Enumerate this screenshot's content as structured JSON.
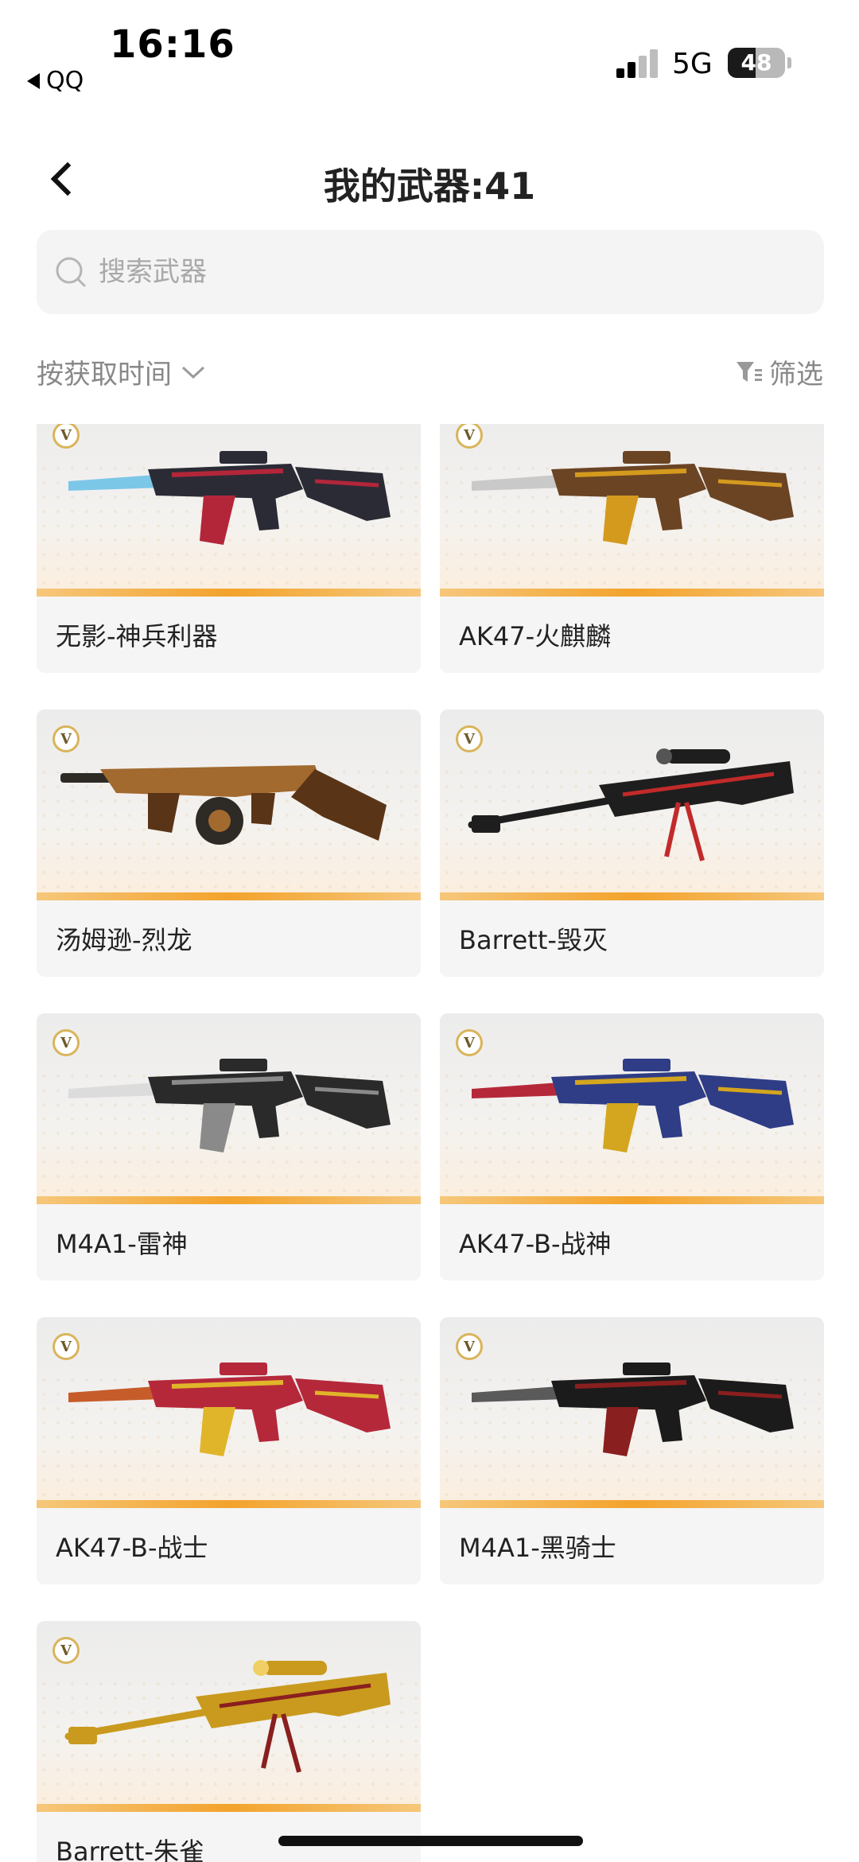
{
  "status_bar": {
    "time": "16:16",
    "back_app": "QQ",
    "network": "5G",
    "battery": "48",
    "battery_level": 0.48
  },
  "header": {
    "back_icon": "chevron-left-icon",
    "title": "我的武器:41"
  },
  "search": {
    "placeholder": "搜索武器",
    "icon": "search-icon"
  },
  "toolbar": {
    "sort_label": "按获取时间",
    "sort_icon": "chevron-down-icon",
    "filter_label": "筛选",
    "filter_icon": "funnel-icon"
  },
  "weapons": [
    {
      "name": "无影-神兵利器",
      "badge": "V",
      "icon": "rifle-image",
      "palette": [
        "#2b2b35",
        "#b3263a",
        "#7bc7e8"
      ]
    },
    {
      "name": "AK47-火麒麟",
      "badge": "V",
      "icon": "rifle-image",
      "palette": [
        "#6b4424",
        "#d49a1e",
        "#c9c9c9"
      ]
    },
    {
      "name": "汤姆逊-烈龙",
      "badge": "V",
      "icon": "smg-image",
      "palette": [
        "#5a3416",
        "#a26a2f",
        "#2e2a26"
      ]
    },
    {
      "name": "Barrett-毁灭",
      "badge": "V",
      "icon": "sniper-image",
      "palette": [
        "#1e1e1e",
        "#c22a2a",
        "#555555"
      ]
    },
    {
      "name": "M4A1-雷神",
      "badge": "V",
      "icon": "rifle-image",
      "palette": [
        "#2a2a2a",
        "#8a8a8a",
        "#dcdcdc"
      ]
    },
    {
      "name": "AK47-B-战神",
      "badge": "V",
      "icon": "rifle-image",
      "palette": [
        "#2f3d86",
        "#d4a51e",
        "#b5283a"
      ]
    },
    {
      "name": "AK47-B-战士",
      "badge": "V",
      "icon": "rifle-image",
      "palette": [
        "#b5283a",
        "#e0b52a",
        "#c65c2a"
      ]
    },
    {
      "name": "M4A1-黑骑士",
      "badge": "V",
      "icon": "rifle-image",
      "palette": [
        "#1b1b1b",
        "#8a1f1f",
        "#5a5a5a"
      ]
    },
    {
      "name": "Barrett-朱雀",
      "badge": "V",
      "icon": "sniper-image",
      "palette": [
        "#c99a1e",
        "#8a1f1f",
        "#f0d064"
      ]
    }
  ]
}
